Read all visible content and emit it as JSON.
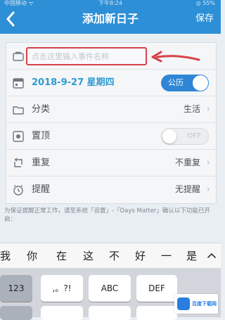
{
  "status_bar": {
    "carrier": "中国移动 ᯤ",
    "time": "下午8:24",
    "battery": "◎ 55%"
  },
  "nav": {
    "back_icon": "chevron-left",
    "title": "添加新日子",
    "save_label": "保存",
    "color": "#2d8fd6"
  },
  "form": {
    "name_placeholder": "点击这里输入事件名称",
    "date": "2018-9-27 星期四",
    "calendar_toggle_label": "公历",
    "category_label": "分类",
    "category_value": "生活",
    "pin_label": "置顶",
    "pin_toggle_label": "OFF",
    "repeat_label": "重复",
    "repeat_value": "不重复",
    "reminder_label": "提醒",
    "reminder_value": "无提醒",
    "accent": "#2f9bd0",
    "highlight": "#d7424a"
  },
  "notice": "为保证提醒正常工作，请至系统「设置」-「Days Matter」确认以下功能已开启：",
  "keyboard": {
    "candidates": [
      "我",
      "你",
      "在",
      "这",
      "不",
      "好",
      "一",
      "是"
    ],
    "expand_icon": "chevron-up",
    "keys": [
      "123",
      ",。?!",
      "ABC",
      "DEF"
    ]
  },
  "watermark": {
    "text": "百度下载网"
  }
}
